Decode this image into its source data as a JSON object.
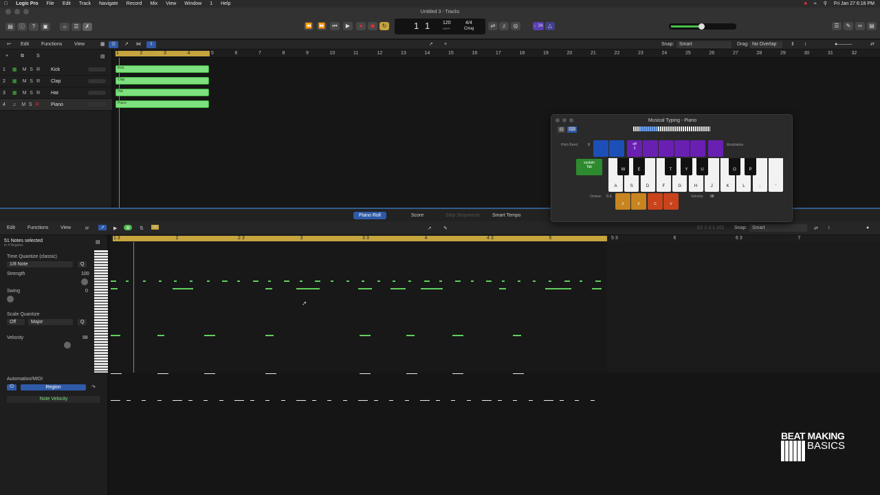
{
  "menubar": {
    "app": "Logic Pro",
    "items": [
      "File",
      "Edit",
      "Track",
      "Navigate",
      "Record",
      "Mix",
      "View",
      "Window",
      "1",
      "Help"
    ],
    "datetime": "Fri Jan 27  6:18 PM"
  },
  "window_title": "Untitled 3 - Tracks",
  "lcd": {
    "bar": "1",
    "beat": "1",
    "tempo": "120",
    "tempo_label": "KEEP",
    "signature": "4/4",
    "key": "Cmaj",
    "cpu": "♩34"
  },
  "tracks_toolbar": {
    "edit": "Edit",
    "functions": "Functions",
    "view": "View",
    "snap_label": "Snap:",
    "snap_value": "Smart",
    "drag_label": "Drag:",
    "drag_value": "No Overlap"
  },
  "tracks": [
    {
      "num": "1",
      "name": "Kick",
      "region": "Kick"
    },
    {
      "num": "2",
      "name": "Clap",
      "region": "Clap"
    },
    {
      "num": "3",
      "name": "Hat",
      "region": "Hat"
    },
    {
      "num": "4",
      "name": "Piano",
      "region": "Piano"
    }
  ],
  "ruler_top": [
    "1",
    "2",
    "3",
    "4",
    "5",
    "6",
    "7",
    "8",
    "9",
    "10",
    "11",
    "12",
    "13",
    "14",
    "15",
    "16",
    "17",
    "18",
    "19",
    "20",
    "21",
    "22",
    "23",
    "24",
    "25",
    "26",
    "27",
    "28",
    "29",
    "30",
    "31",
    "32"
  ],
  "bottom_tabs": {
    "piano_roll": "Piano Roll",
    "score": "Score",
    "step": "Step Sequencer",
    "smart_tempo": "Smart Tempo"
  },
  "piano_toolbar": {
    "edit": "Edit",
    "functions": "Functions",
    "view": "View",
    "position": "E2   2 3 1 161",
    "snap_label": "Snap:",
    "snap_value": "Smart"
  },
  "inspector": {
    "selected": "51 Notes selected",
    "regions": "in 4 Regions",
    "time_quantize_label": "Time Quantize (classic)",
    "time_quantize_value": "1/8 Note",
    "q": "Q",
    "strength_label": "Strength",
    "strength_value": "100",
    "swing_label": "Swing",
    "swing_value": "0",
    "scale_quantize_label": "Scale Quantize",
    "scale_off": "Off",
    "scale_major": "Major",
    "velocity_label": "Velocity",
    "velocity_value": "98",
    "automation_label": "Automation/MIDI",
    "region_btn": "Region",
    "note_velocity": "Note Velocity"
  },
  "ruler_piano": [
    "1 3",
    "2",
    "2 3",
    "3",
    "3 3",
    "4",
    "4 3",
    "5",
    "5 3",
    "6",
    "6 3",
    "7"
  ],
  "musical_typing": {
    "title": "Musical Typing - Piano",
    "pitch_bend_label": "Pitch Bend",
    "pitch_bend_value": "0",
    "modulation_label": "Modulation",
    "sustain": "sustain",
    "tab": "Tab",
    "off": "off",
    "three": "3",
    "octave_label": "Octave:",
    "octave_value": "C-1",
    "velocity_label": "Velocity:",
    "velocity_value": "98",
    "white_keys": [
      "A",
      "S",
      "D",
      "F",
      "G",
      "H",
      "J",
      "K",
      "L",
      ";",
      "'"
    ],
    "black_keys": [
      "W",
      "E",
      "T",
      "Y",
      "U",
      "O",
      "P"
    ],
    "octave_pads": [
      "Z",
      "X"
    ],
    "velocity_pads": [
      "C",
      "V"
    ]
  },
  "logo": {
    "line1": "BEAT MAKING",
    "line2": "BASICS"
  },
  "colors": {
    "region": "#7ee07e",
    "note": "#5fd15f",
    "accent_blue": "#2f5aa8",
    "ruler_gold": "#c6a53f"
  }
}
